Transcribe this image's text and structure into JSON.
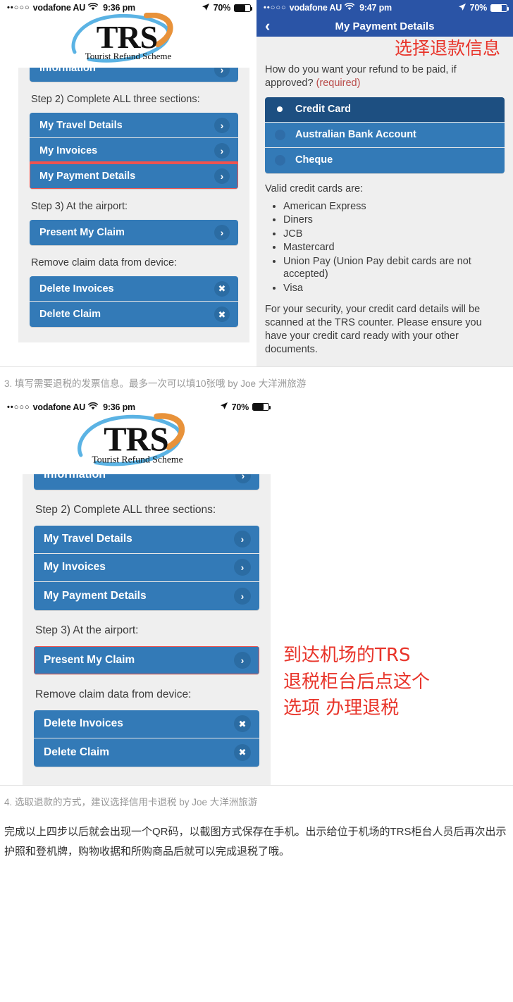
{
  "figure1": {
    "left_screen": {
      "status": {
        "dots": "••○○○",
        "carrier": "vodafone AU",
        "wifi_icon": "wifi-icon",
        "time": "9:36 pm",
        "location_icon": "location-arrow-icon",
        "battery_pct": "70%"
      },
      "logo": {
        "title": "TRS",
        "subtitle": "Tourist Refund Scheme"
      },
      "partial_button": {
        "label": "Information",
        "icon": "chevron-right-icon"
      },
      "step2_label": "Step 2) Complete ALL three sections:",
      "step2_buttons": [
        {
          "label": "My Travel Details",
          "icon": "chevron-right-icon",
          "highlighted": false
        },
        {
          "label": "My Invoices",
          "icon": "chevron-right-icon",
          "highlighted": false
        },
        {
          "label": "My Payment Details",
          "icon": "chevron-right-icon",
          "highlighted": true
        }
      ],
      "step3_label": "Step 3) At the airport:",
      "step3_buttons": [
        {
          "label": "Present My Claim",
          "icon": "chevron-right-icon",
          "highlighted": false
        }
      ],
      "remove_label": "Remove claim data from device:",
      "delete_buttons": [
        {
          "label": "Delete Invoices",
          "icon": "cross-icon"
        },
        {
          "label": "Delete Claim",
          "icon": "cross-icon"
        }
      ]
    },
    "right_screen": {
      "status": {
        "dots": "••○○○",
        "carrier": "vodafone AU",
        "wifi_icon": "wifi-icon",
        "time": "9:47 pm",
        "location_icon": "location-arrow-icon",
        "battery_pct": "70%"
      },
      "navbar": {
        "back_icon": "chevron-left-icon",
        "title": "My Payment Details"
      },
      "annotation": "选择退款信息",
      "question": "How do you want your refund to be paid, if approved?",
      "required_tag": "(required)",
      "options": [
        {
          "label": "Credit Card",
          "selected": true
        },
        {
          "label": "Australian Bank Account",
          "selected": false
        },
        {
          "label": "Cheque",
          "selected": false
        }
      ],
      "valid_cards_heading": "Valid credit cards are:",
      "valid_cards": [
        "American Express",
        "Diners",
        "JCB",
        "Mastercard",
        "Union Pay (Union Pay debit cards are not accepted)",
        "Visa"
      ],
      "security_note": "For your security, your credit card details will be scanned at the TRS counter. Please ensure you have your credit card ready with your other documents."
    },
    "caption": "3. 填写需要退税的发票信息。最多一次可以填10张哦 by Joe 大洋洲旅游"
  },
  "figure2": {
    "screen": {
      "status": {
        "dots": "••○○○",
        "carrier": "vodafone AU",
        "wifi_icon": "wifi-icon",
        "time": "9:36 pm",
        "location_icon": "location-arrow-icon",
        "battery_pct": "70%"
      },
      "logo": {
        "title": "TRS",
        "subtitle": "Tourist Refund Scheme"
      },
      "partial_button": {
        "label": "Information",
        "icon": "chevron-right-icon"
      },
      "step2_label": "Step 2) Complete ALL three sections:",
      "step2_buttons": [
        {
          "label": "My Travel Details",
          "icon": "chevron-right-icon",
          "highlighted": false
        },
        {
          "label": "My Invoices",
          "icon": "chevron-right-icon",
          "highlighted": false
        },
        {
          "label": "My Payment Details",
          "icon": "chevron-right-icon",
          "highlighted": false
        }
      ],
      "step3_label": "Step 3) At the airport:",
      "step3_buttons": [
        {
          "label": "Present My Claim",
          "icon": "chevron-right-icon",
          "highlighted": true
        }
      ],
      "remove_label": "Remove claim data from device:",
      "delete_buttons": [
        {
          "label": "Delete Invoices",
          "icon": "cross-icon"
        },
        {
          "label": "Delete Claim",
          "icon": "cross-icon"
        }
      ]
    },
    "annotation_lines": [
      "到达机场的TRS",
      "退税柜台后点这个",
      "选项 办理退税"
    ],
    "caption": "4. 选取退款的方式，建议选择信用卡退税 by Joe 大洋洲旅游"
  },
  "closing_paragraph": "完成以上四步以后就会出现一个QR码，以截图方式保存在手机。出示给位于机场的TRS柜台人员后再次出示护照和登机牌，购物收据和所购商品后就可以完成退税了哦。",
  "colors": {
    "button_blue": "#337ab7",
    "navbar_blue": "#2a54a6",
    "selected_blue": "#1d4f81",
    "highlight_red": "#ef5350",
    "annotation_red": "#e8342a",
    "screen_gray": "#efefef"
  }
}
